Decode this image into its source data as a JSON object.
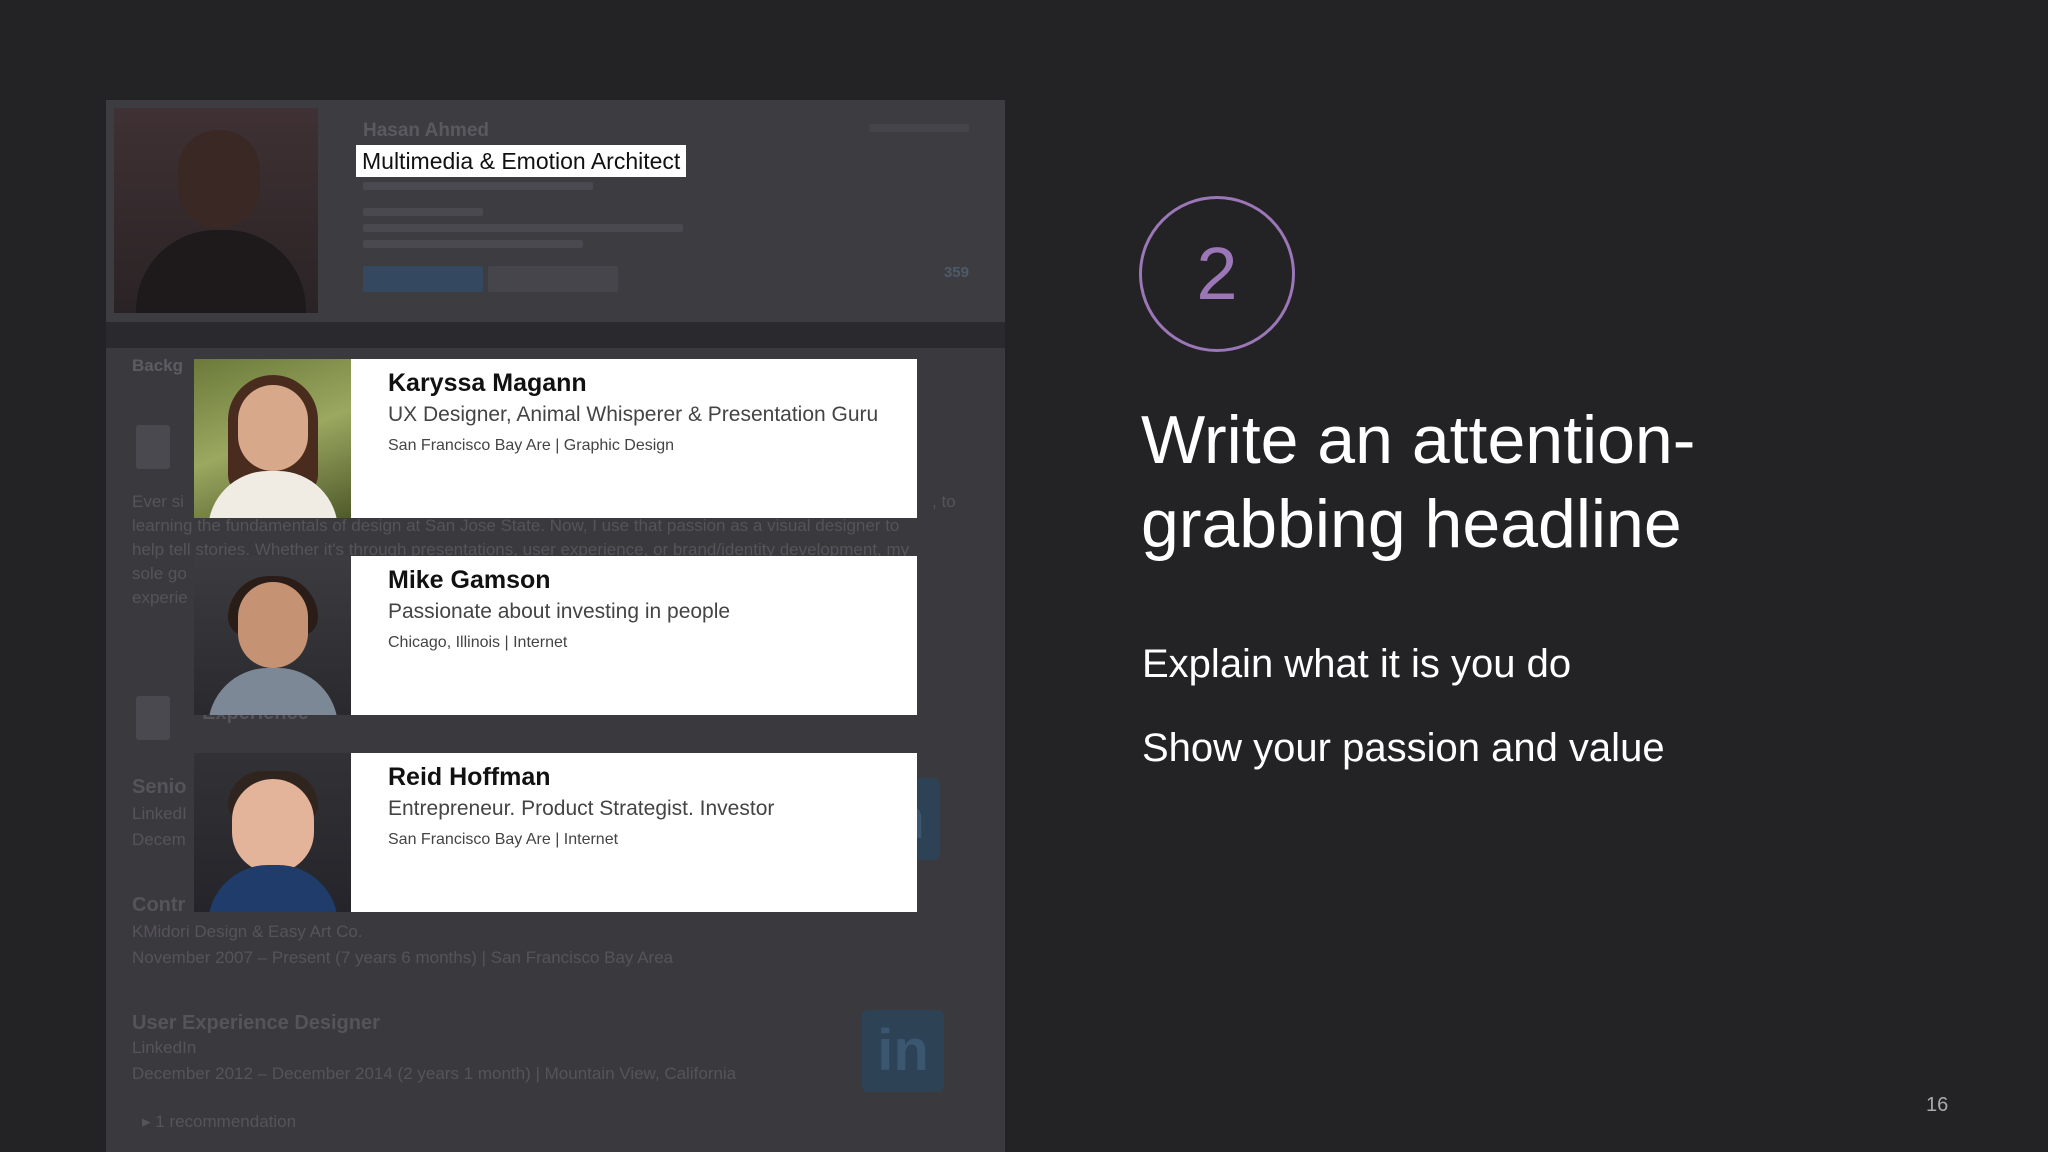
{
  "background_screenshot": {
    "name": "Hasan Ahmed",
    "highlighted_headline": "Multimedia & Emotion Architect",
    "connections": "359",
    "tab": "Backg",
    "summary_lines": [
      "Ever si",
      "learning the fundamentals of design at San Jose State. Now, I use that passion as a visual designer to",
      "help tell stories. Whether it's through presentations, user experience, or brand/identity development, my",
      "sole go",
      "experie"
    ],
    "summary_end": ", to",
    "experience_heading": "Experience",
    "jobs": [
      {
        "title": "Senio",
        "company": "LinkedI",
        "dates": "Decem"
      },
      {
        "title": "Contr",
        "company": "KMidori Design & Easy Art Co.",
        "dates": "November 2007 – Present (7 years 6 months) | San Francisco Bay Area"
      },
      {
        "title": "User Experience Designer",
        "company": "LinkedIn",
        "dates": "December 2012 – December 2014 (2 years 1 month) | Mountain View, California"
      }
    ],
    "recommendation": "1 recommendation",
    "logo_text": "in"
  },
  "cards": [
    {
      "name": "Karyssa Magann",
      "title": "UX Designer, Animal Whisperer & Presentation Guru",
      "location": "San Francisco Bay Are | Graphic Design"
    },
    {
      "name": "Mike Gamson",
      "title": "Passionate about investing in people",
      "location": "Chicago, Illinois | Internet"
    },
    {
      "name": "Reid Hoffman",
      "title": "Entrepreneur. Product Strategist. Investor",
      "location": "San Francisco Bay Are | Internet"
    }
  ],
  "slide": {
    "step_number": "2",
    "heading": "Write an attention-grabbing headline",
    "points": [
      "Explain what it is you do",
      "Show your passion and value"
    ],
    "page_number": "16",
    "accent_color": "#9b77b7"
  }
}
